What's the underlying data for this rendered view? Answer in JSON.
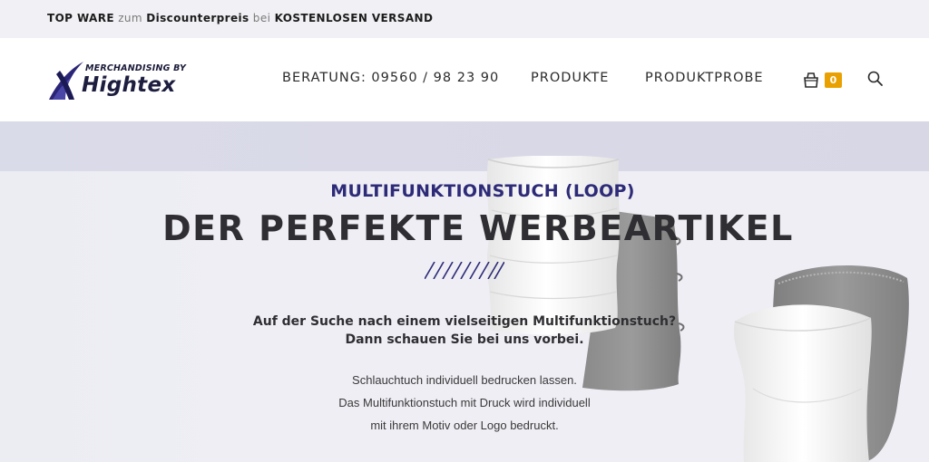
{
  "topbar": {
    "part1": "TOP WARE",
    "part2": "zum",
    "part3": "Discounterpreis",
    "part4": "bei",
    "part5": "KOSTENLOSEN VERSAND"
  },
  "logo": {
    "tagline": "MERCHANDISING BY",
    "brand": "Hightex"
  },
  "nav": {
    "items": [
      {
        "label": "BERATUNG: 09560 / 98 23 90"
      },
      {
        "label": "PRODUKTE"
      },
      {
        "label": "PRODUKTPROBE"
      }
    ],
    "cart_count": "0"
  },
  "hero": {
    "subtitle": "MULTIFUNKTIONSTUCH (LOOP)",
    "title": "DER PERFEKTE WERBEARTIKEL",
    "lead": [
      "Auf der Suche nach einem vielseitigen Multifunktionstuch?",
      "Dann schauen Sie bei uns vorbei."
    ],
    "body": [
      "Schlauchtuch individuell bedrucken lassen.",
      "Das Multifunktionstuch mit Druck wird individuell",
      "mit ihrem Motiv oder Logo bedruckt."
    ]
  },
  "colors": {
    "accent": "#2d2a78",
    "badge": "#e8a100",
    "topbar_bg": "#f1f1f5",
    "hero_bg": "#eeeef4"
  },
  "icons": {
    "cart": "shopping-bag-icon",
    "search": "search-icon"
  }
}
